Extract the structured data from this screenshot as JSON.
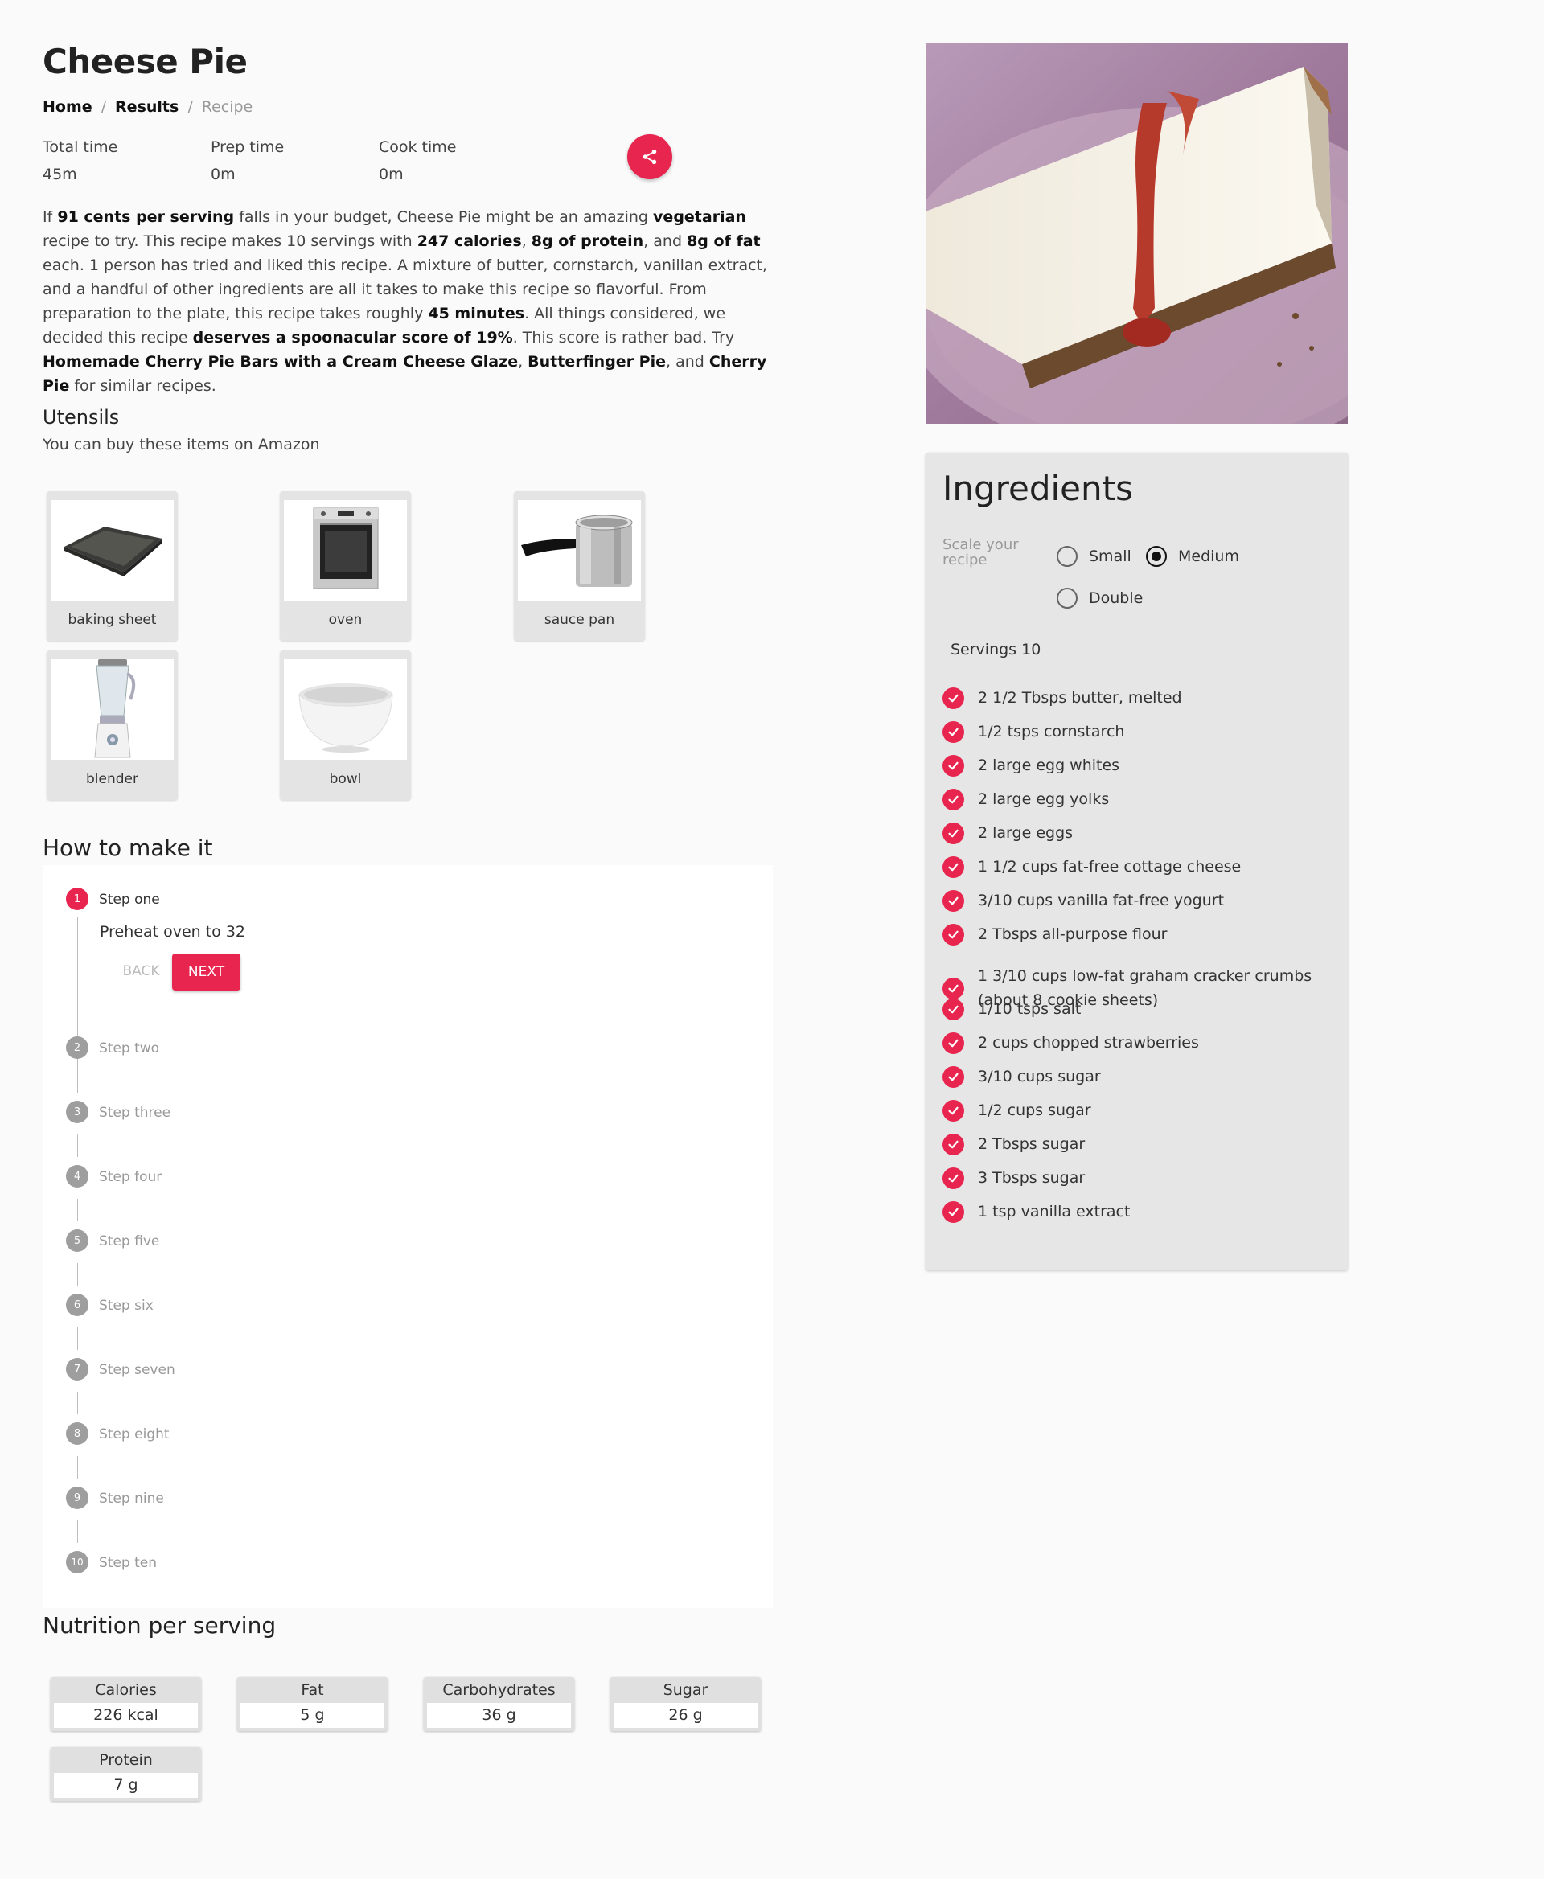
{
  "recipe": {
    "title": "Cheese Pie",
    "breadcrumb": {
      "home": "Home",
      "results": "Results",
      "current": "Recipe",
      "separator": "/"
    },
    "times": [
      {
        "label": "Total time",
        "value": "45m"
      },
      {
        "label": "Prep time",
        "value": "0m"
      },
      {
        "label": "Cook time",
        "value": "0m"
      }
    ],
    "share_icon": "share-icon",
    "summary": {
      "s1": "If ",
      "b1": "91 cents per serving",
      "s2": " falls in your budget, Cheese Pie might be an amazing ",
      "b2": "vegetarian",
      "s3": " recipe to try. This recipe makes 10 servings with ",
      "b3": "247 calories",
      "s4": ", ",
      "b4": "8g of protein",
      "s5": ", and ",
      "b5": "8g of fat",
      "s6": " each. 1 person has tried and liked this recipe. A mixture of butter, cornstarch, vanillan extract, and a handful of other ingredients are all it takes to make this recipe so flavorful. From preparation to the plate, this recipe takes roughly ",
      "b6": "45 minutes",
      "s7": ". All things considered, we decided this recipe ",
      "b7": "deserves a spoonacular score of 19%",
      "s8": ". This score is rather bad. Try ",
      "b8": "Homemade Cherry Pie Bars with a Cream Cheese Glaze",
      "s9": ", ",
      "b9": "Butterfinger Pie",
      "s10": ", and ",
      "b10": "Cherry Pie",
      "s11": " for similar recipes."
    }
  },
  "utensils": {
    "heading": "Utensils",
    "subtitle": "You can buy these items on Amazon",
    "items": [
      {
        "name": "baking sheet"
      },
      {
        "name": "oven"
      },
      {
        "name": "sauce pan"
      },
      {
        "name": "blender"
      },
      {
        "name": "bowl"
      }
    ]
  },
  "instructions": {
    "heading": "How to make it",
    "active_step": 1,
    "active_text": "Preheat oven to 32",
    "back_label": "BACK",
    "next_label": "NEXT",
    "steps": [
      {
        "number": "1",
        "label": "Step one"
      },
      {
        "number": "2",
        "label": "Step two"
      },
      {
        "number": "3",
        "label": "Step three"
      },
      {
        "number": "4",
        "label": "Step four"
      },
      {
        "number": "5",
        "label": "Step five"
      },
      {
        "number": "6",
        "label": "Step six"
      },
      {
        "number": "7",
        "label": "Step seven"
      },
      {
        "number": "8",
        "label": "Step eight"
      },
      {
        "number": "9",
        "label": "Step nine"
      },
      {
        "number": "10",
        "label": "Step ten"
      }
    ]
  },
  "nutrition": {
    "heading": "Nutrition per serving",
    "items": [
      {
        "label": "Calories",
        "value": "226 kcal"
      },
      {
        "label": "Fat",
        "value": "5 g"
      },
      {
        "label": "Carbohydrates",
        "value": "36 g"
      },
      {
        "label": "Sugar",
        "value": "26 g"
      },
      {
        "label": "Protein",
        "value": "7 g"
      }
    ]
  },
  "ingredients": {
    "heading": "Ingredients",
    "scale_label": "Scale your recipe",
    "scale_options": [
      {
        "label": "Small",
        "selected": false
      },
      {
        "label": "Medium",
        "selected": true
      },
      {
        "label": "Double",
        "selected": false
      }
    ],
    "servings": "Servings 10",
    "items": [
      "2 1/2 Tbsps butter, melted",
      "1/2 tsps cornstarch",
      "2 large egg whites",
      "2 large egg yolks",
      "2 large eggs",
      "1 1/2 cups fat-free cottage cheese",
      "3/10 cups vanilla fat-free yogurt",
      "2 Tbsps all-purpose flour",
      "1 3/10 cups low-fat graham cracker crumbs (about 8 cookie sheets)",
      "1/10 tsps salt",
      "2 cups chopped strawberries",
      "3/10 cups sugar",
      "1/2 cups sugar",
      "2 Tbsps sugar",
      "3 Tbsps sugar",
      "1 tsp vanilla extract"
    ]
  },
  "colors": {
    "accent": "#e8254f",
    "card": "#e6e6e6",
    "background": "#fafafa"
  }
}
